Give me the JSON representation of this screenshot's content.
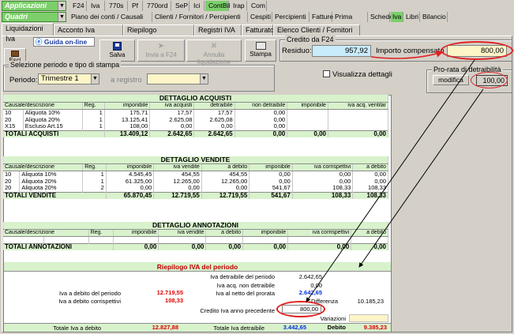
{
  "top_menu": {
    "app_combo": "Applicazioni",
    "section_combo": "Quadri",
    "row1": [
      "F24",
      "Iva",
      "770s",
      "Pf",
      "770ord",
      "SeP",
      "Ici",
      "ContBil",
      "Irap",
      "Com"
    ],
    "row2": [
      "Piano dei conti / Causali",
      "Clienti / Fornitori / Percipienti",
      "Cespiti",
      "Percipienti",
      "Fatture",
      "Prima nota",
      "Schede",
      "Iva",
      "Libri",
      "Bilancio"
    ]
  },
  "tabs": [
    "Liquidazioni Iva",
    "Acconto Iva Dicembre",
    "Riepilogo liquidazioni",
    "Registri IVA",
    "Fatturato",
    "Elenco Clienti / Fornitori"
  ],
  "toolbar": {
    "guida": "Guida on-line",
    "esci": "Esci",
    "salva": "Salva",
    "invia": "Invia a F24",
    "annulla": "Annulla liquidazione",
    "stampa": "Stampa"
  },
  "credito": {
    "title": "Credito da F24",
    "residuo_label": "Residuo:",
    "residuo_value": "957,92",
    "importo_label": "Importo compensato",
    "importo_value": "800,00"
  },
  "selezione": {
    "title": "Selezione periodo e tipo di stampa",
    "periodo_label": "Periodo:",
    "periodo_value": "Trimestre 1",
    "registro_label": "a registro"
  },
  "visualizza": "Visualizza dettagli",
  "prorata": {
    "title": "Pro-rata di detraibilità",
    "modifica": "modifica",
    "value": "100,00"
  },
  "acquisti": {
    "title": "DETTAGLIO ACQUISTI",
    "cols": [
      "Causale/descrizione",
      "Reg.",
      "imponibile",
      "iva acquisti",
      "detraibile",
      "non detraibile",
      "imponibile",
      "iva acq. ventilar"
    ],
    "rows": [
      [
        "10",
        "Aliquota 10%",
        "1",
        "175,71",
        "17,57",
        "17,57",
        "0,00",
        "",
        ""
      ],
      [
        "20",
        "Aliquota 20%",
        "1",
        "13.125,41",
        "2.625,08",
        "2.625,08",
        "0,00",
        "",
        ""
      ],
      [
        "X15",
        "Escluso Art.15",
        "1",
        "108,00",
        "0,00",
        "0,00",
        "0,00",
        "",
        ""
      ]
    ],
    "total": [
      "TOTALI ACQUISTI",
      "13.409,12",
      "2.642,65",
      "2.642,65",
      "0,00",
      "0,00",
      "0,00"
    ]
  },
  "vendite": {
    "title": "DETTAGLIO VENDITE",
    "cols": [
      "Causale/descrizione",
      "Reg.",
      "imponibile",
      "iva vendite",
      "a debito",
      "imponibile",
      "iva corrispettivi",
      "a debito"
    ],
    "rows": [
      [
        "10",
        "Aliquota 10%",
        "1",
        "4.545,45",
        "454,55",
        "454,55",
        "0,00",
        "0,00",
        "0,00"
      ],
      [
        "20",
        "Aliquota 20%",
        "1",
        "61.325,00",
        "12.265,00",
        "12.265,00",
        "0,00",
        "0,00",
        "0,00"
      ],
      [
        "20",
        "Aliquota 20%",
        "2",
        "0,00",
        "0,00",
        "0,00",
        "541,67",
        "108,33",
        "108,33"
      ]
    ],
    "total": [
      "TOTALI VENDITE",
      "65.870,45",
      "12.719,55",
      "12.719,55",
      "541,67",
      "108,33",
      "108,33"
    ]
  },
  "annotazioni": {
    "title": "DETTAGLIO ANNOTAZIONI",
    "cols": [
      "Causale/descrizione",
      "Reg.",
      "imponibile",
      "iva vendite",
      "a debito",
      "imponibile",
      "iva corrispettivi",
      "a debito"
    ],
    "total": [
      "TOTALI ANNOTAZIONI",
      "0,00",
      "0,00",
      "0,00",
      "0,00",
      "0,00",
      "0,00"
    ]
  },
  "riepilogo": {
    "title": "Riepilogo IVA del periodo",
    "iva_detraibile_label": "Iva detraibile del periodo",
    "iva_detraibile": "2.642,65",
    "iva_non_detraibile_label": "Iva acq. non detraibile",
    "iva_non_detraibile": "0,00",
    "iva_debito_label": "Iva a debito del periodo",
    "iva_debito": "12.719,55",
    "iva_prorata_label": "Iva al netto del prorata",
    "iva_prorata": "2.642,65",
    "iva_corrispettivi_label": "Iva a debito corrispettivi",
    "iva_corrispettivi": "108,33",
    "differenza_label": "Differenza",
    "differenza": "10.185,23",
    "credito_label": "Credito Iva anno precedente",
    "credito": "800,00",
    "variazioni_label": "Variazioni",
    "totale_debito_label": "Totale Iva a debito",
    "totale_debito": "12.827,88",
    "totale_detraibile_label": "Totale Iva detraibile",
    "totale_detraibile": "3.442,65",
    "debito_label": "Debito",
    "debito": "9.385,23"
  }
}
